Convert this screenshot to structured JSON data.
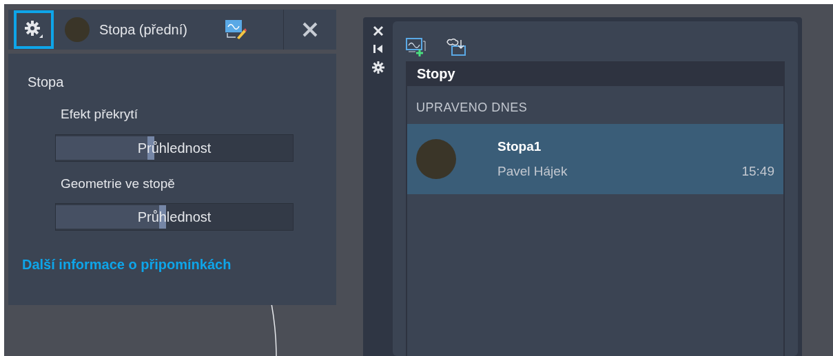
{
  "trace_panel": {
    "title": "Stopa (přední)",
    "heading": "Stopa",
    "sliders": [
      {
        "label": "Efekt překrytí",
        "value_text": "Průhlednost",
        "level": 0.4
      },
      {
        "label": "Geometrie ve stopě",
        "value_text": "Průhlednost",
        "level": 0.45
      }
    ],
    "link": "Další informace o připomínkách"
  },
  "traces_palette": {
    "title": "Stopy",
    "group": "UPRAVENO DNES",
    "items": [
      {
        "name": "Stopa1",
        "author": "Pavel Hájek",
        "time": "15:49",
        "selected": true
      }
    ]
  }
}
